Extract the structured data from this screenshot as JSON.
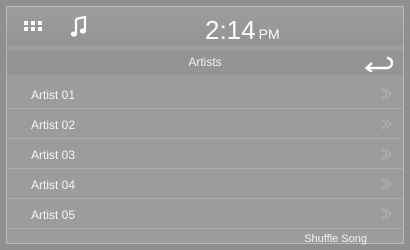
{
  "status": {
    "time": "2:14",
    "ampm": "PM"
  },
  "header": {
    "title": "Artists"
  },
  "list": {
    "items": [
      {
        "label": "Artist 01"
      },
      {
        "label": "Artist 02"
      },
      {
        "label": "Artist 03"
      },
      {
        "label": "Artist 04"
      },
      {
        "label": "Artist 05"
      }
    ]
  },
  "footer": {
    "shuffle_label": "Shuffle Song"
  },
  "icons": {
    "menu": "grid-icon",
    "music": "music-note-icon",
    "back": "back-arrow-icon",
    "row_chevron": "double-chevron-right-icon"
  }
}
